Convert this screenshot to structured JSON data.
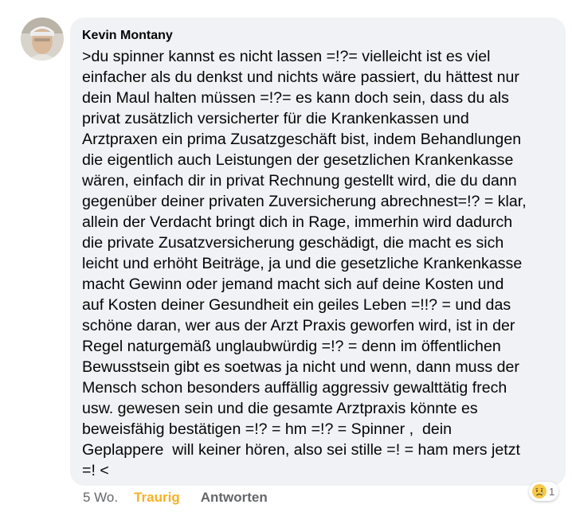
{
  "comment": {
    "author": "Kevin Montany",
    "lines": [
      ">du spinner kannst es nicht lassen =!?= vielleicht ist es viel",
      "einfacher als du denkst und nichts wäre passiert, du hättest nur",
      "dein Maul halten müssen =!?= es kann doch sein, dass du als",
      "privat zusätzlich versicherter für die Krankenkassen und",
      "Arztpraxen ein prima Zusatzgeschäft bist, indem Behandlungen",
      "die eigentlich auch Leistungen der gesetzlichen Krankenkasse",
      "wären, einfach dir in privat Rechnung gestellt wird, die du dann",
      "gegenüber deiner privaten Zuversicherung abrechnest=!? = klar,",
      "allein der Verdacht bringt dich in Rage, immerhin wird dadurch",
      "die private Zusatzversicherung geschädigt, die macht es sich",
      "leicht und erhöht Beiträge, ja und die gesetzliche Krankenkasse",
      "macht Gewinn oder jemand macht sich auf deine Kosten und",
      "auf Kosten deiner Gesundheit ein geiles Leben =!!? = und das",
      "schöne daran, wer aus der Arzt Praxis geworfen wird, ist in der",
      "Regel naturgemäß unglaubwürdig =!? = denn im öffentlichen",
      "Bewusstsein gibt es soetwas ja nicht und wenn, dann muss der",
      "Mensch schon besonders auffällig aggressiv gewalttätig frech",
      "usw. gewesen sein und die gesamte Arztpraxis könnte es",
      "beweisfähig bestätigen =!? = hm =!? = Spinner ,  dein",
      "Geplappere  will keiner hören, also sei stille =! = ham mers jetzt",
      "=! <"
    ],
    "reactions": {
      "icon": "sad-reaction-icon",
      "count": "1"
    }
  },
  "actions": {
    "timestamp": "5 Wo.",
    "react_label": "Traurig",
    "react_color": "#f7b125",
    "reply_label": "Antworten"
  }
}
